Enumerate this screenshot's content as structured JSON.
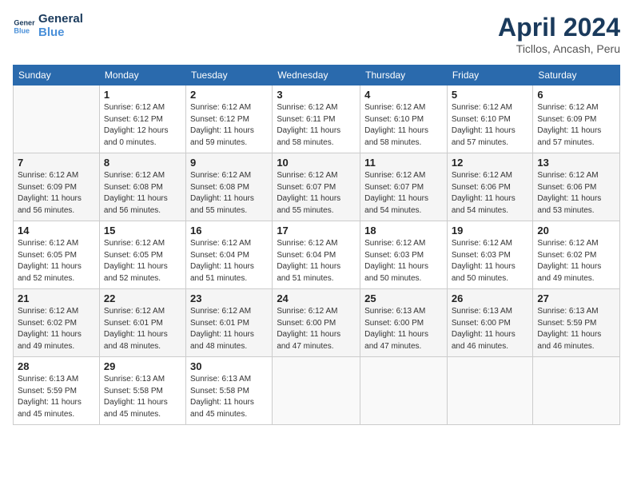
{
  "header": {
    "logo_line1": "General",
    "logo_line2": "Blue",
    "month_year": "April 2024",
    "location": "Ticllos, Ancash, Peru"
  },
  "weekdays": [
    "Sunday",
    "Monday",
    "Tuesday",
    "Wednesday",
    "Thursday",
    "Friday",
    "Saturday"
  ],
  "weeks": [
    [
      {
        "day": "",
        "info": ""
      },
      {
        "day": "1",
        "info": "Sunrise: 6:12 AM\nSunset: 6:12 PM\nDaylight: 12 hours\nand 0 minutes."
      },
      {
        "day": "2",
        "info": "Sunrise: 6:12 AM\nSunset: 6:12 PM\nDaylight: 11 hours\nand 59 minutes."
      },
      {
        "day": "3",
        "info": "Sunrise: 6:12 AM\nSunset: 6:11 PM\nDaylight: 11 hours\nand 58 minutes."
      },
      {
        "day": "4",
        "info": "Sunrise: 6:12 AM\nSunset: 6:10 PM\nDaylight: 11 hours\nand 58 minutes."
      },
      {
        "day": "5",
        "info": "Sunrise: 6:12 AM\nSunset: 6:10 PM\nDaylight: 11 hours\nand 57 minutes."
      },
      {
        "day": "6",
        "info": "Sunrise: 6:12 AM\nSunset: 6:09 PM\nDaylight: 11 hours\nand 57 minutes."
      }
    ],
    [
      {
        "day": "7",
        "info": "Sunrise: 6:12 AM\nSunset: 6:09 PM\nDaylight: 11 hours\nand 56 minutes."
      },
      {
        "day": "8",
        "info": "Sunrise: 6:12 AM\nSunset: 6:08 PM\nDaylight: 11 hours\nand 56 minutes."
      },
      {
        "day": "9",
        "info": "Sunrise: 6:12 AM\nSunset: 6:08 PM\nDaylight: 11 hours\nand 55 minutes."
      },
      {
        "day": "10",
        "info": "Sunrise: 6:12 AM\nSunset: 6:07 PM\nDaylight: 11 hours\nand 55 minutes."
      },
      {
        "day": "11",
        "info": "Sunrise: 6:12 AM\nSunset: 6:07 PM\nDaylight: 11 hours\nand 54 minutes."
      },
      {
        "day": "12",
        "info": "Sunrise: 6:12 AM\nSunset: 6:06 PM\nDaylight: 11 hours\nand 54 minutes."
      },
      {
        "day": "13",
        "info": "Sunrise: 6:12 AM\nSunset: 6:06 PM\nDaylight: 11 hours\nand 53 minutes."
      }
    ],
    [
      {
        "day": "14",
        "info": "Sunrise: 6:12 AM\nSunset: 6:05 PM\nDaylight: 11 hours\nand 52 minutes."
      },
      {
        "day": "15",
        "info": "Sunrise: 6:12 AM\nSunset: 6:05 PM\nDaylight: 11 hours\nand 52 minutes."
      },
      {
        "day": "16",
        "info": "Sunrise: 6:12 AM\nSunset: 6:04 PM\nDaylight: 11 hours\nand 51 minutes."
      },
      {
        "day": "17",
        "info": "Sunrise: 6:12 AM\nSunset: 6:04 PM\nDaylight: 11 hours\nand 51 minutes."
      },
      {
        "day": "18",
        "info": "Sunrise: 6:12 AM\nSunset: 6:03 PM\nDaylight: 11 hours\nand 50 minutes."
      },
      {
        "day": "19",
        "info": "Sunrise: 6:12 AM\nSunset: 6:03 PM\nDaylight: 11 hours\nand 50 minutes."
      },
      {
        "day": "20",
        "info": "Sunrise: 6:12 AM\nSunset: 6:02 PM\nDaylight: 11 hours\nand 49 minutes."
      }
    ],
    [
      {
        "day": "21",
        "info": "Sunrise: 6:12 AM\nSunset: 6:02 PM\nDaylight: 11 hours\nand 49 minutes."
      },
      {
        "day": "22",
        "info": "Sunrise: 6:12 AM\nSunset: 6:01 PM\nDaylight: 11 hours\nand 48 minutes."
      },
      {
        "day": "23",
        "info": "Sunrise: 6:12 AM\nSunset: 6:01 PM\nDaylight: 11 hours\nand 48 minutes."
      },
      {
        "day": "24",
        "info": "Sunrise: 6:12 AM\nSunset: 6:00 PM\nDaylight: 11 hours\nand 47 minutes."
      },
      {
        "day": "25",
        "info": "Sunrise: 6:13 AM\nSunset: 6:00 PM\nDaylight: 11 hours\nand 47 minutes."
      },
      {
        "day": "26",
        "info": "Sunrise: 6:13 AM\nSunset: 6:00 PM\nDaylight: 11 hours\nand 46 minutes."
      },
      {
        "day": "27",
        "info": "Sunrise: 6:13 AM\nSunset: 5:59 PM\nDaylight: 11 hours\nand 46 minutes."
      }
    ],
    [
      {
        "day": "28",
        "info": "Sunrise: 6:13 AM\nSunset: 5:59 PM\nDaylight: 11 hours\nand 45 minutes."
      },
      {
        "day": "29",
        "info": "Sunrise: 6:13 AM\nSunset: 5:58 PM\nDaylight: 11 hours\nand 45 minutes."
      },
      {
        "day": "30",
        "info": "Sunrise: 6:13 AM\nSunset: 5:58 PM\nDaylight: 11 hours\nand 45 minutes."
      },
      {
        "day": "",
        "info": ""
      },
      {
        "day": "",
        "info": ""
      },
      {
        "day": "",
        "info": ""
      },
      {
        "day": "",
        "info": ""
      }
    ]
  ]
}
